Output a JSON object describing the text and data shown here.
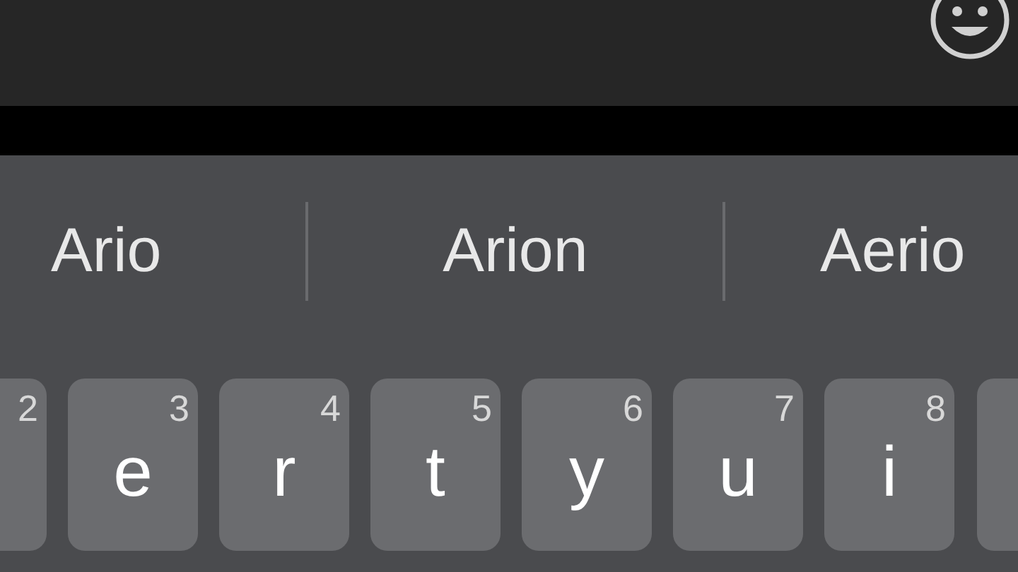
{
  "suggestions": [
    {
      "text": "Ario"
    },
    {
      "text": "Arion"
    },
    {
      "text": "Aerio"
    }
  ],
  "keys": [
    {
      "kind": "cut",
      "number": "2"
    },
    {
      "kind": "full",
      "letter": "e",
      "number": "3"
    },
    {
      "kind": "full",
      "letter": "r",
      "number": "4"
    },
    {
      "kind": "full",
      "letter": "t",
      "number": "5"
    },
    {
      "kind": "full",
      "letter": "y",
      "number": "6"
    },
    {
      "kind": "full",
      "letter": "u",
      "number": "7"
    },
    {
      "kind": "full",
      "letter": "i",
      "number": "8"
    },
    {
      "kind": "edge"
    }
  ]
}
